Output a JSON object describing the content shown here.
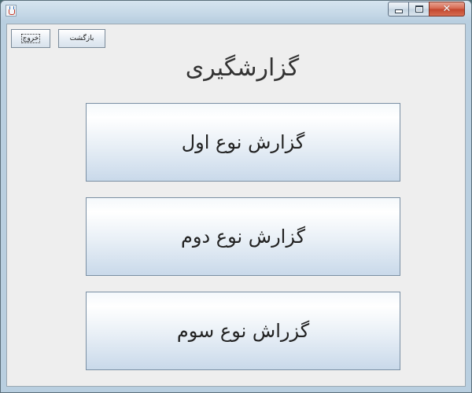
{
  "window": {
    "icon": "java-icon",
    "controls": {
      "minimize": "minimize-icon",
      "maximize": "maximize-icon",
      "close_glyph": "✕"
    }
  },
  "toolbar": {
    "exit_label": "خروج",
    "back_label": "بازگشت"
  },
  "main": {
    "title": "گزارشگیری",
    "buttons": [
      {
        "label": "گزارش نوع اول"
      },
      {
        "label": "گزارش نوع دوم"
      },
      {
        "label": "گزراش نوع سوم"
      }
    ]
  }
}
